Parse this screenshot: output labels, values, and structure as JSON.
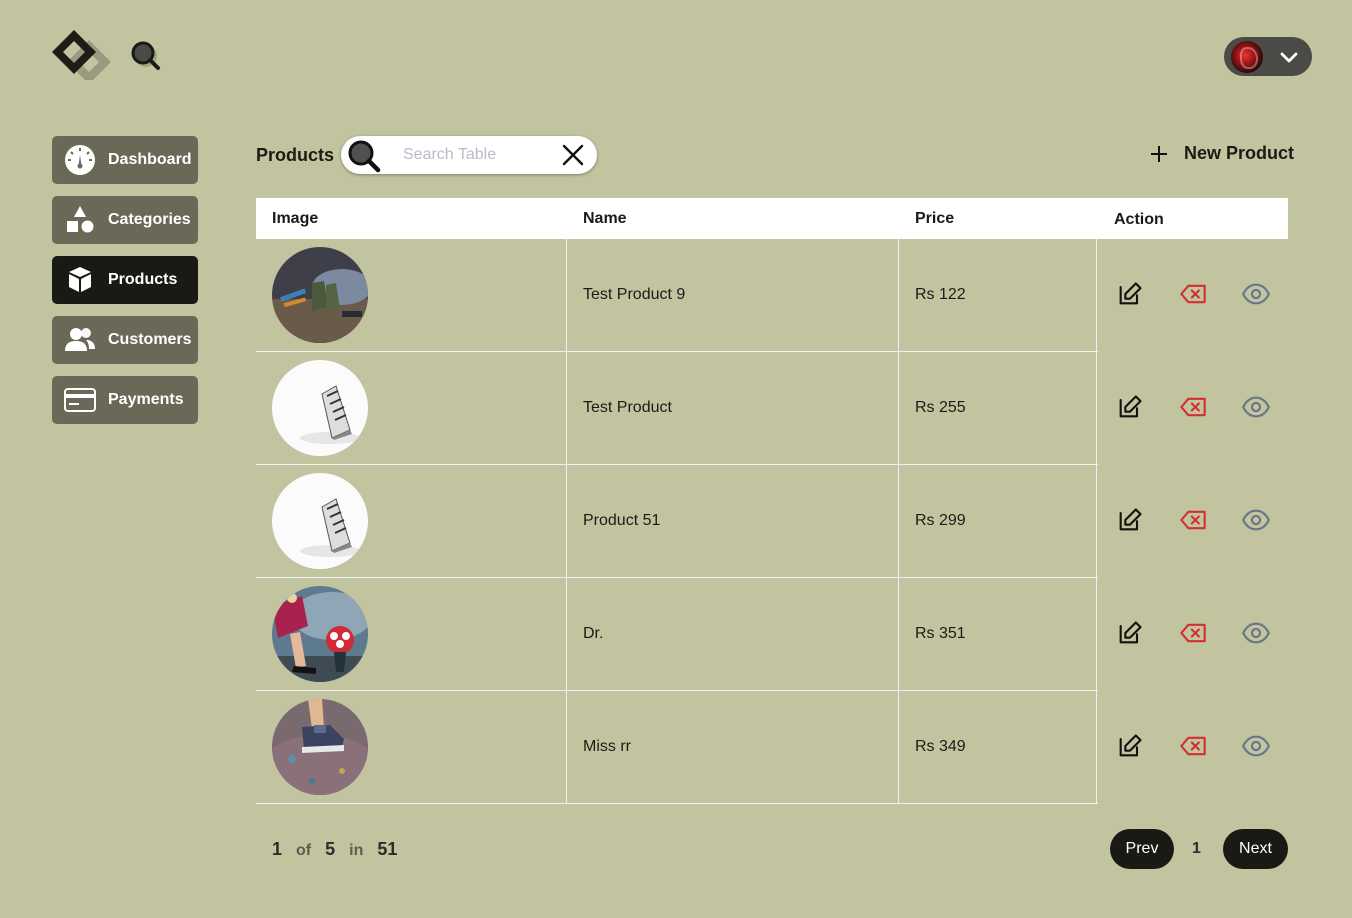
{
  "header": {
    "logo_icon": "diamond-logo-icon",
    "search_icon": "search-icon",
    "user_menu_icon": "chevron-down-icon"
  },
  "sidebar": {
    "items": [
      {
        "label": "Dashboard",
        "icon": "speedometer-icon",
        "active": false
      },
      {
        "label": "Categories",
        "icon": "shapes-icon",
        "active": false
      },
      {
        "label": "Products",
        "icon": "box-icon",
        "active": true
      },
      {
        "label": "Customers",
        "icon": "users-icon",
        "active": false
      },
      {
        "label": "Payments",
        "icon": "credit-card-icon",
        "active": false
      }
    ]
  },
  "toolbar": {
    "title": "Products",
    "search_placeholder": "Search Table",
    "search_value": "",
    "new_product_label": "New Product"
  },
  "table": {
    "columns": [
      "Image",
      "Name",
      "Price",
      "Action"
    ],
    "rows": [
      {
        "name": "Test Product 9",
        "price": "Rs 122",
        "image": "boots-photo"
      },
      {
        "name": "Test Product",
        "price": "Rs 255",
        "image": "shoe-white-photo"
      },
      {
        "name": "Product 51",
        "price": "Rs 299",
        "image": "shoe-white-photo"
      },
      {
        "name": "Dr.",
        "price": "Rs 351",
        "image": "heels-flowers-photo"
      },
      {
        "name": "Miss rr",
        "price": "Rs 349",
        "image": "sneakers-photo"
      }
    ],
    "actions": [
      "edit-icon",
      "delete-icon",
      "view-icon"
    ]
  },
  "pagination": {
    "page": "1",
    "of_label": "of",
    "total_pages": "5",
    "in_label": "in",
    "total_items": "51",
    "prev_label": "Prev",
    "current": "1",
    "next_label": "Next"
  },
  "colors": {
    "background": "#c2c49f",
    "nav_item": "#6a6857",
    "nav_active": "#1a1a14",
    "delete": "#d32f2f",
    "view": "#6a7489"
  }
}
